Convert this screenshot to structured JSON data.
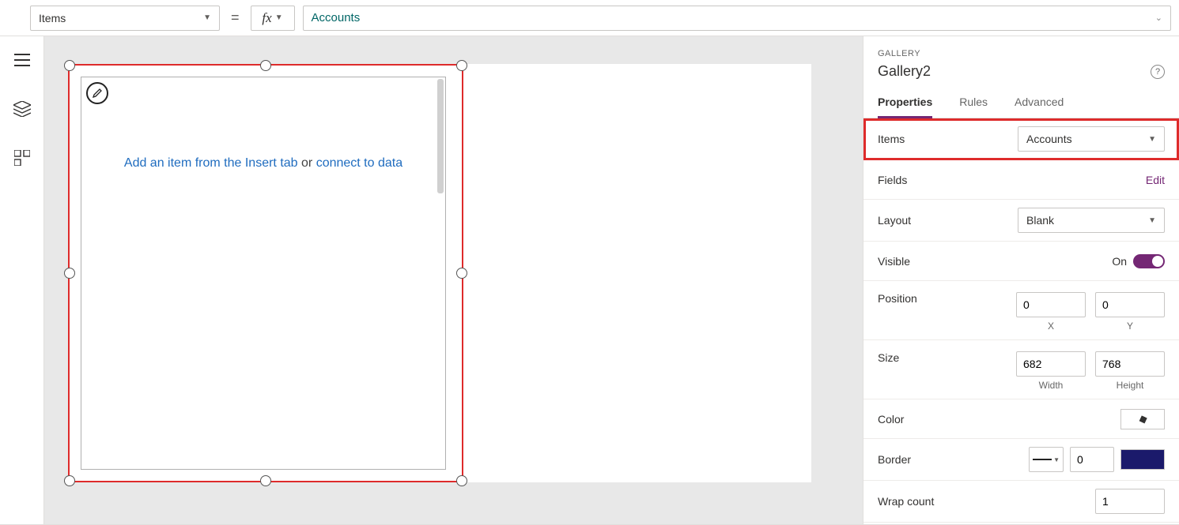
{
  "formula": {
    "property": "Items",
    "expression": "Accounts"
  },
  "canvas": {
    "placeholder_prefix": "Add an item from the Insert tab",
    "placeholder_or": " or ",
    "placeholder_link": "connect to data"
  },
  "pane": {
    "type": "GALLERY",
    "name": "Gallery2",
    "tabs": {
      "properties": "Properties",
      "rules": "Rules",
      "advanced": "Advanced"
    },
    "items_label": "Items",
    "items_value": "Accounts",
    "fields_label": "Fields",
    "fields_action": "Edit",
    "layout_label": "Layout",
    "layout_value": "Blank",
    "visible_label": "Visible",
    "visible_value": "On",
    "position_label": "Position",
    "pos_x": "0",
    "pos_y": "0",
    "pos_x_sub": "X",
    "pos_y_sub": "Y",
    "size_label": "Size",
    "size_w": "682",
    "size_h": "768",
    "size_w_sub": "Width",
    "size_h_sub": "Height",
    "color_label": "Color",
    "border_label": "Border",
    "border_width": "0",
    "wrap_label": "Wrap count",
    "wrap_value": "1"
  }
}
